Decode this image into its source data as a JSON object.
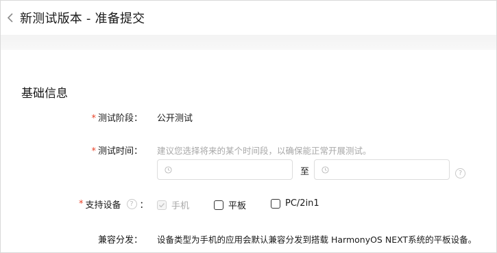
{
  "header": {
    "title": "新测试版本 - 准备提交",
    "back_icon": "chevron-left-icon"
  },
  "section": {
    "title": "基础信息"
  },
  "fields": {
    "stage": {
      "required_mark": "*",
      "label": "测试阶段：",
      "value": "公开测试"
    },
    "time": {
      "required_mark": "*",
      "label": "测试时间：",
      "hint": "建议您选择将来的某个时间段，以确保能正常开展测试。",
      "start_placeholder": "",
      "end_placeholder": "",
      "separator": "至"
    },
    "devices": {
      "required_mark": "*",
      "label": "支持设备",
      "help": "?",
      "colon": "：",
      "options": [
        {
          "label": "手机",
          "checked": true,
          "disabled": true
        },
        {
          "label": "平板",
          "checked": false,
          "disabled": false
        },
        {
          "label": "PC/2in1",
          "checked": false,
          "disabled": false
        }
      ]
    },
    "compat": {
      "label": "兼容分发：",
      "value": "设备类型为手机的应用会默认兼容分发到搭载 HarmonyOS NEXT系统的平板设备。"
    }
  },
  "colors": {
    "required": "#e84026",
    "hint": "#a8a8a8",
    "text": "#191919"
  }
}
